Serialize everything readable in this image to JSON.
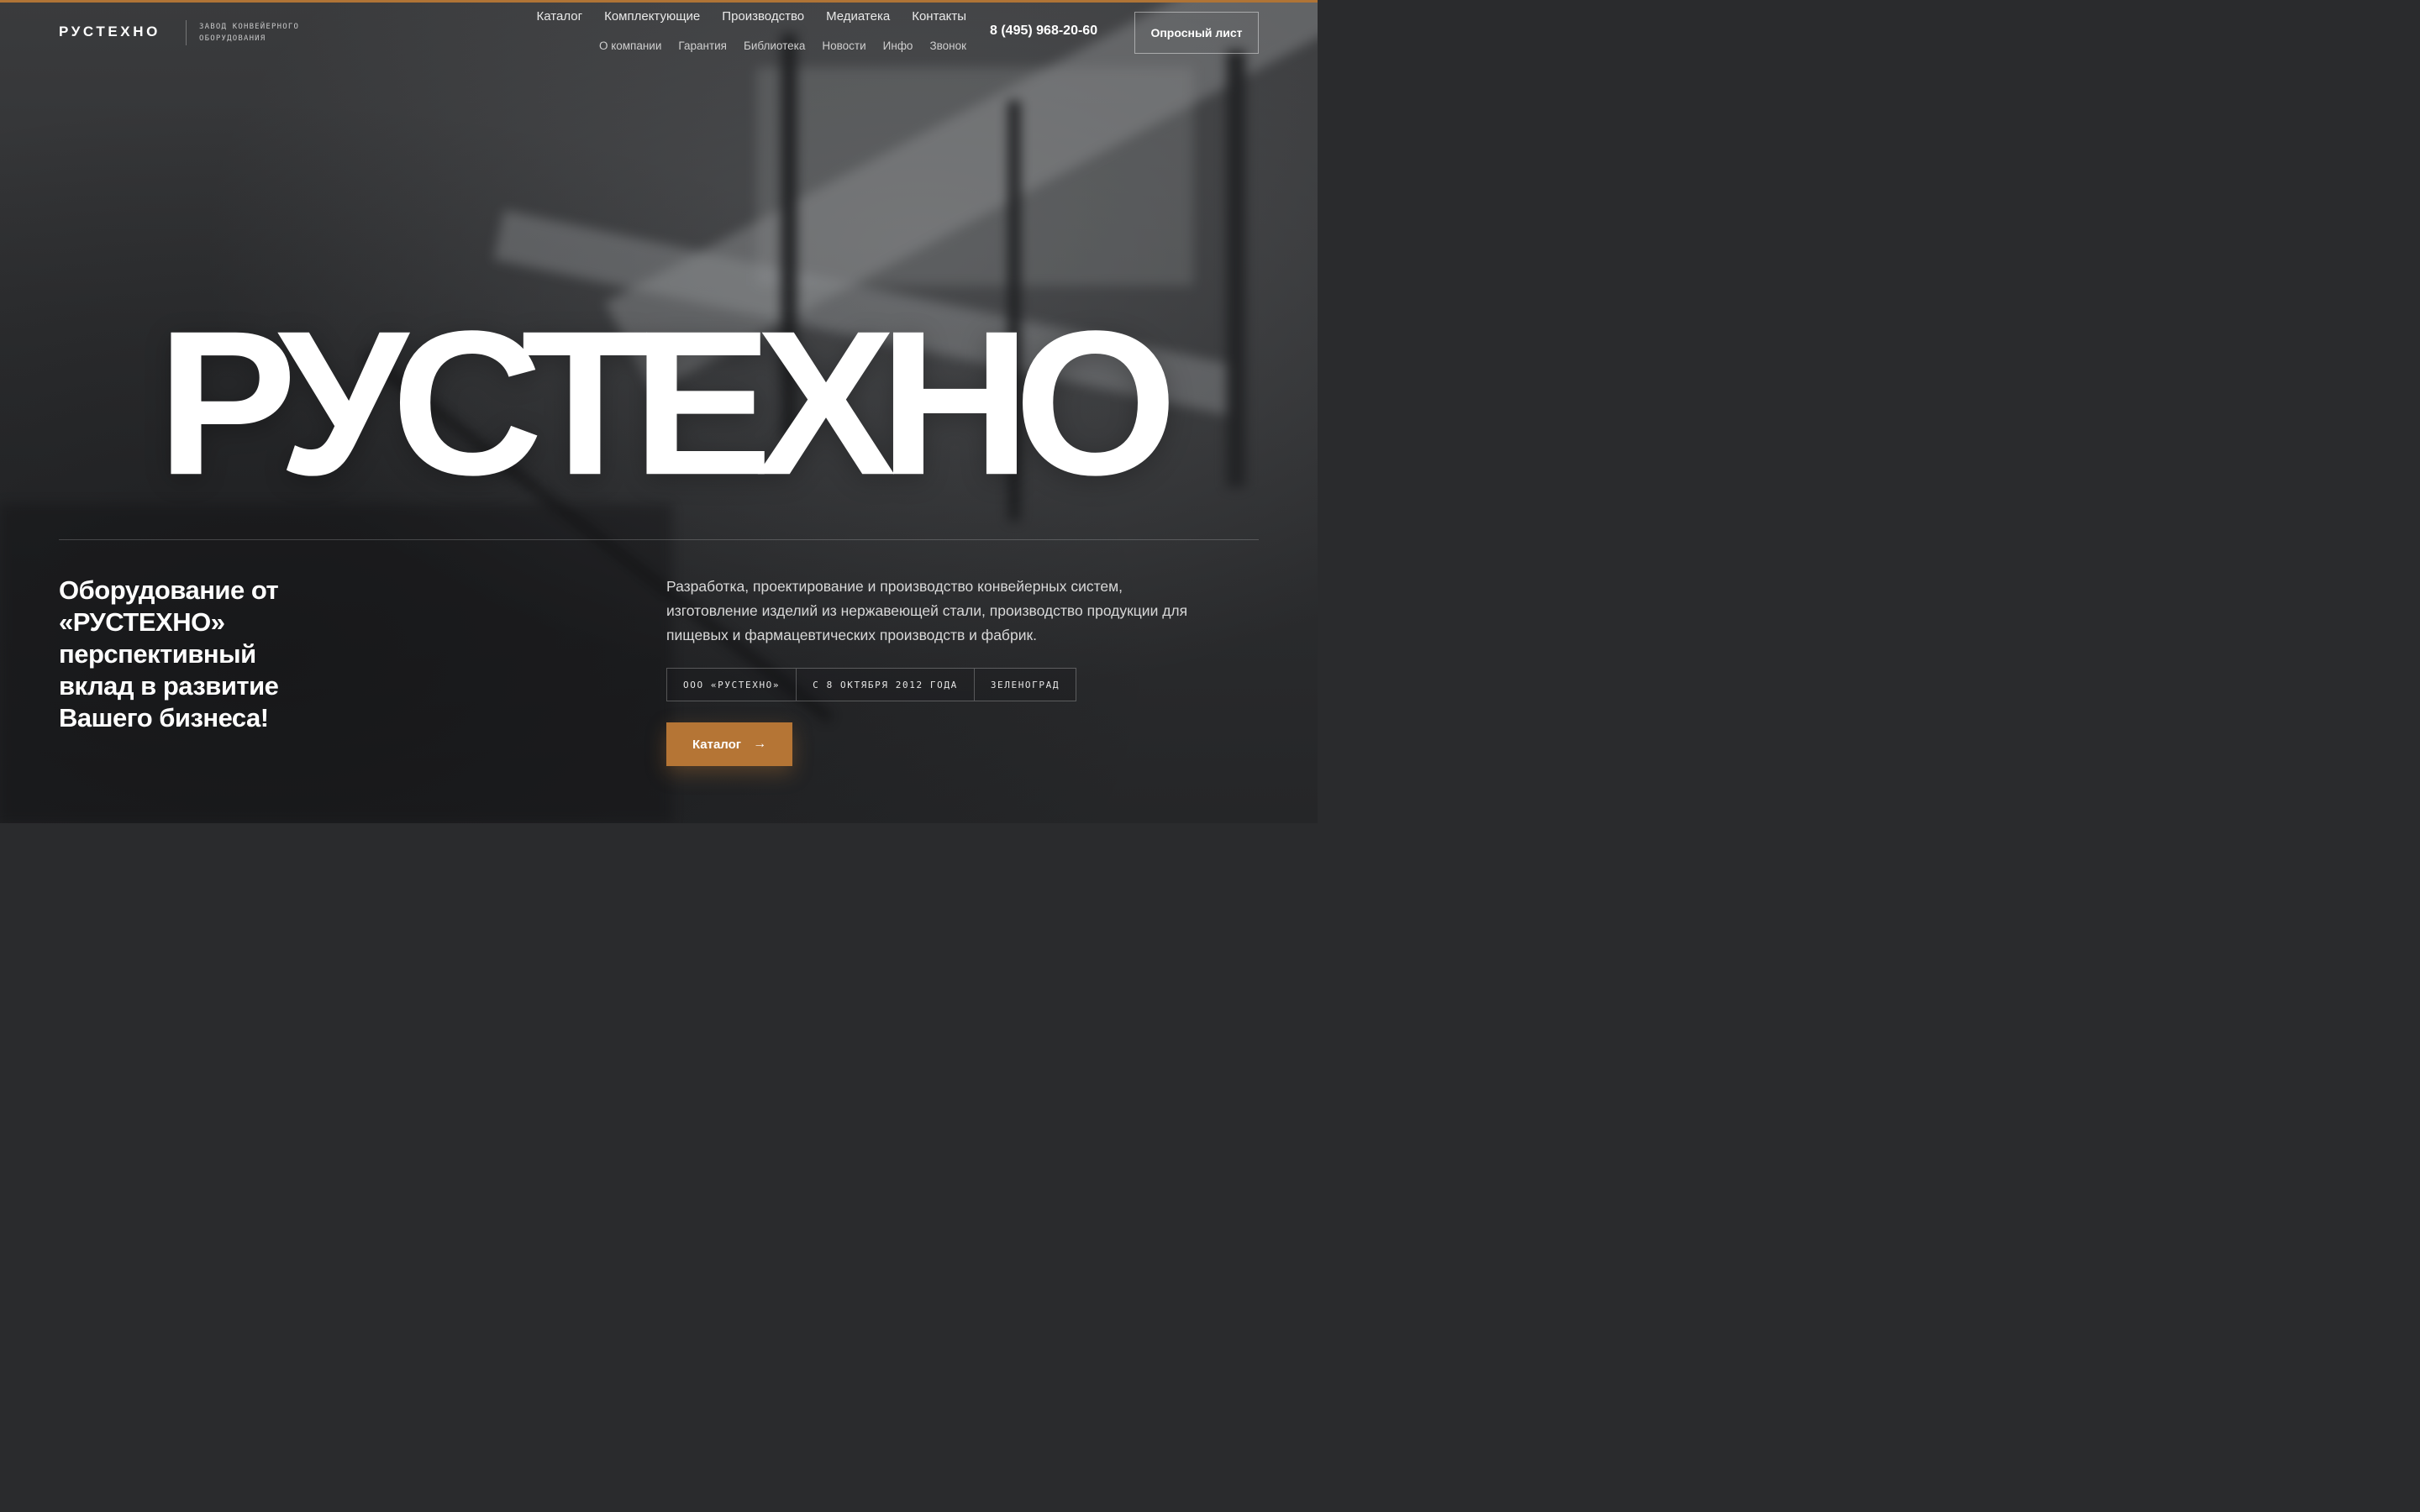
{
  "brand": {
    "name": "РУСТЕХНО",
    "tagline": "Завод конвейерного оборудования"
  },
  "nav": {
    "main": [
      "Каталог",
      "Комплектующие",
      "Производство",
      "Медиатека",
      "Контакты"
    ],
    "sub": [
      "О компании",
      "Гарантия",
      "Библиотека",
      "Новости",
      "Инфо",
      "Звонок"
    ]
  },
  "contact": {
    "phone": "8 (495) 968-20-60",
    "survey_label": "Опросный лист"
  },
  "hero": {
    "headline": "РУСТЕХНО",
    "slogan": "Оборудование от «РУСТЕХНО» перспективный вклад в развитие Вашего бизнеса!",
    "description": "Разработка, проектирование и производство конвейерных систем, изготовление изделий из нержавеющей стали, производство продукции для пищевых и фармацевтических производств и фабрик.",
    "facts": [
      "ООО «РУСТЕХНО»",
      "С 8 ОКТЯБРЯ 2012 ГОДА",
      "ЗЕЛЕНОГРАД"
    ],
    "cta_label": "Каталог",
    "cta_icon": "arrow-right-icon"
  },
  "colors": {
    "accent": "#b57535",
    "background": "#2a2b2d",
    "text": "#ffffff"
  }
}
